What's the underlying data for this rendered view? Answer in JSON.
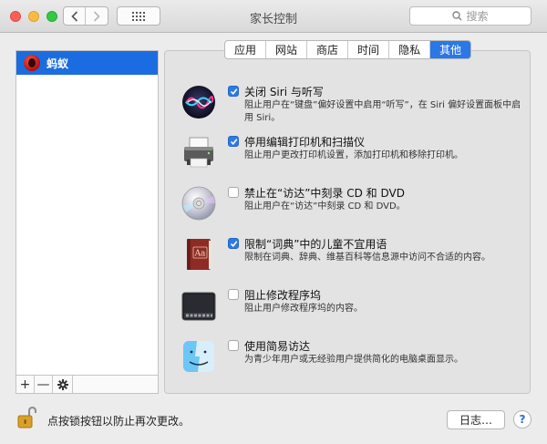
{
  "window": {
    "title": "家长控制",
    "search_placeholder": "搜索"
  },
  "sidebar": {
    "users": [
      {
        "name": "蚂蚁",
        "selected": true
      }
    ],
    "toolbar": {
      "add": "+",
      "remove": "—",
      "action_icon": "gear-icon"
    }
  },
  "tabs": [
    {
      "label": "应用",
      "active": false
    },
    {
      "label": "网站",
      "active": false
    },
    {
      "label": "商店",
      "active": false
    },
    {
      "label": "时间",
      "active": false
    },
    {
      "label": "隐私",
      "active": false
    },
    {
      "label": "其他",
      "active": true
    }
  ],
  "options": [
    {
      "icon": "siri-icon",
      "checked": true,
      "title": "关闭 Siri 与听写",
      "desc": "阻止用户在“键盘”偏好设置中启用“听写”，在 Siri 偏好设置面板中启用 Siri。"
    },
    {
      "icon": "printer-icon",
      "checked": true,
      "title": "停用编辑打印机和扫描仪",
      "desc": "阻止用户更改打印机设置，添加打印机和移除打印机。"
    },
    {
      "icon": "disc-icon",
      "checked": false,
      "title": "禁止在“访达”中刻录 CD 和 DVD",
      "desc": "阻止用户在“访达”中刻录 CD 和 DVD。"
    },
    {
      "icon": "dictionary-icon",
      "checked": true,
      "title": "限制“词典”中的儿童不宜用语",
      "desc": "限制在词典、辞典、维基百科等信息源中访问不合适的内容。"
    },
    {
      "icon": "dock-icon",
      "checked": false,
      "title": "阻止修改程序坞",
      "desc": "阻止用户修改程序坞的内容。"
    },
    {
      "icon": "finder-icon",
      "checked": false,
      "title": "使用简易访达",
      "desc": "为青少年用户或无经验用户提供简化的电脑桌面显示。"
    }
  ],
  "footer": {
    "lock_text": "点按锁按钮以防止再次更改。",
    "log_button": "日志…",
    "help_button": "?"
  },
  "colors": {
    "accent": "#2a77e6",
    "selection": "#1b6ce0"
  }
}
